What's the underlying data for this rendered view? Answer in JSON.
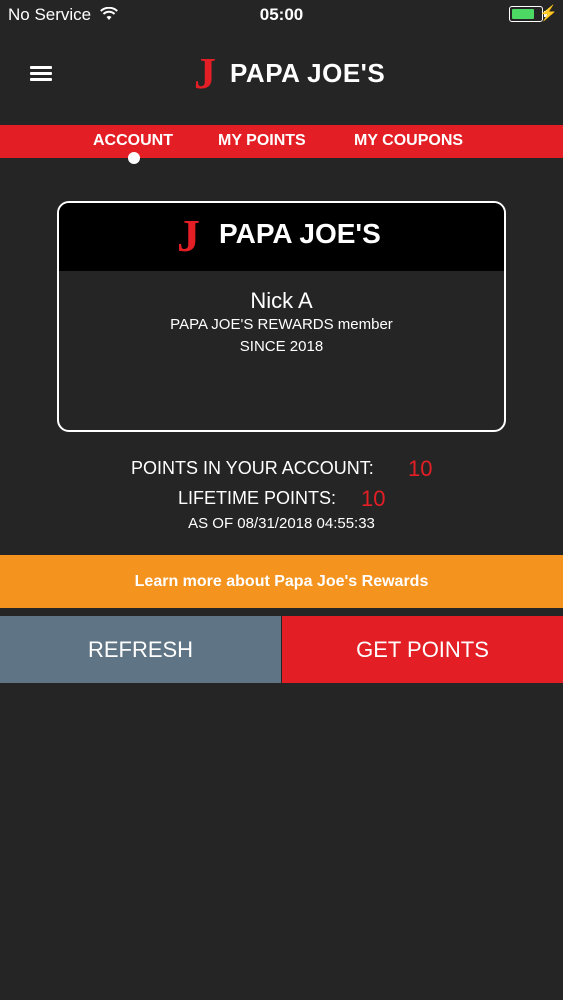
{
  "status_bar": {
    "carrier": "No Service",
    "time": "05:00",
    "battery_color": "#4cd964"
  },
  "header": {
    "logo_letter": "J",
    "brand": "PAPA JOE'S"
  },
  "tabs": [
    {
      "label": "ACCOUNT",
      "active": true
    },
    {
      "label": "MY POINTS",
      "active": false
    },
    {
      "label": "MY COUPONS",
      "active": false
    }
  ],
  "card": {
    "logo_letter": "J",
    "brand": "PAPA JOE'S",
    "member_name": "Nick A",
    "member_line": "PAPA JOE'S REWARDS member",
    "since": "SINCE 2018"
  },
  "points": {
    "account_label": "POINTS IN YOUR ACCOUNT:",
    "account_value": "10",
    "lifetime_label": "LIFETIME POINTS:",
    "lifetime_value": "10",
    "as_of": "AS OF 08/31/2018 04:55:33"
  },
  "learn_more": "Learn more about Papa Joe's Rewards",
  "buttons": {
    "refresh": "REFRESH",
    "get_points": "GET POINTS"
  },
  "colors": {
    "brand_red": "#e41e25",
    "orange": "#f5931f",
    "slate": "#5f7585",
    "background": "#252525"
  }
}
